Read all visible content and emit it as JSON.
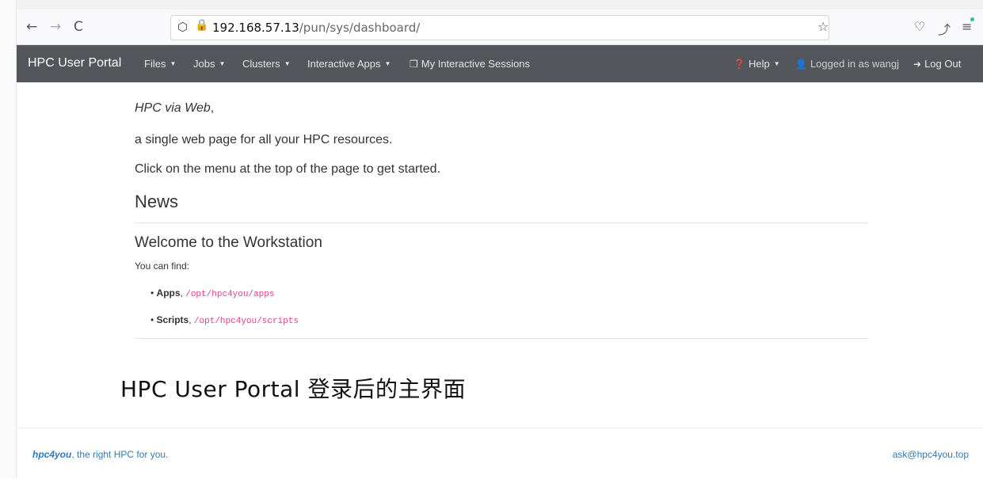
{
  "browser": {
    "back_icon": "←",
    "forward_icon": "→",
    "reload_icon": "C",
    "shield_icon": "⬡",
    "lock_icon": "🔒",
    "url_host": "192.168.57.13",
    "url_path": "/pun/sys/dashboard/",
    "bookmark_icon": "☆",
    "pocket_icon": "♡",
    "extensions_icon": "⤴",
    "menu_icon": "≡"
  },
  "navbar": {
    "brand": "HPC User Portal",
    "items": [
      {
        "label": "Files"
      },
      {
        "label": "Jobs"
      },
      {
        "label": "Clusters"
      },
      {
        "label": "Interactive Apps"
      },
      {
        "label": "My Interactive Sessions"
      }
    ],
    "help": "Help",
    "user": "Logged in as wangj",
    "logout": "Log Out",
    "caret": "▼"
  },
  "content": {
    "intro_emph": "HPC via Web",
    "intro_comma": ",",
    "intro_line2": "a single web page for all your HPC resources.",
    "intro_line3": "Click on the menu at the top of the page to get started.",
    "news_title": "News",
    "post_title": "Welcome to the Workstation",
    "post_intro": "You can find:",
    "bullets": [
      {
        "name": "Apps",
        "sep": ",",
        "path": "/opt/hpc4you/apps"
      },
      {
        "name": "Scripts",
        "sep": ",",
        "path": "/opt/hpc4you/scripts"
      }
    ]
  },
  "caption": "HPC User Portal 登录后的主界面",
  "footer": {
    "brand": "hpc4you",
    "tagline": ", the right HPC for you.",
    "email": "ask@hpc4you.top"
  },
  "colors": {
    "navbar_bg": "#53565a",
    "link": "#337ab7",
    "code": "#e83e8c"
  }
}
